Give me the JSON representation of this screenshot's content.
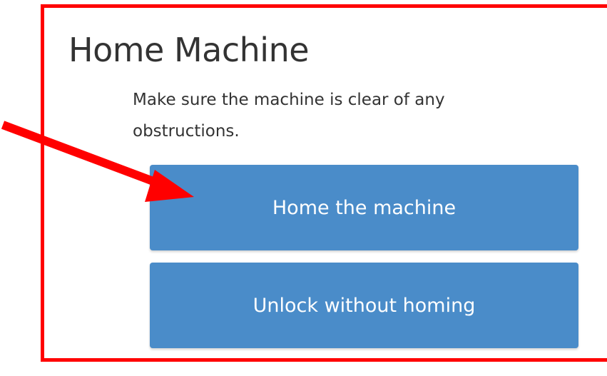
{
  "dialog": {
    "title": "Home Machine",
    "message": "Make sure the machine is clear of any obstructions.",
    "buttons": {
      "home_label": "Home the machine",
      "unlock_label": "Unlock without homing"
    }
  },
  "colors": {
    "button_background": "#4a8cc9",
    "button_text": "#ffffff",
    "annotation_red": "#ff0000",
    "text": "#333333"
  },
  "annotations": {
    "highlight_frame": "red-rectangle",
    "pointer": "red-arrow-icon"
  }
}
